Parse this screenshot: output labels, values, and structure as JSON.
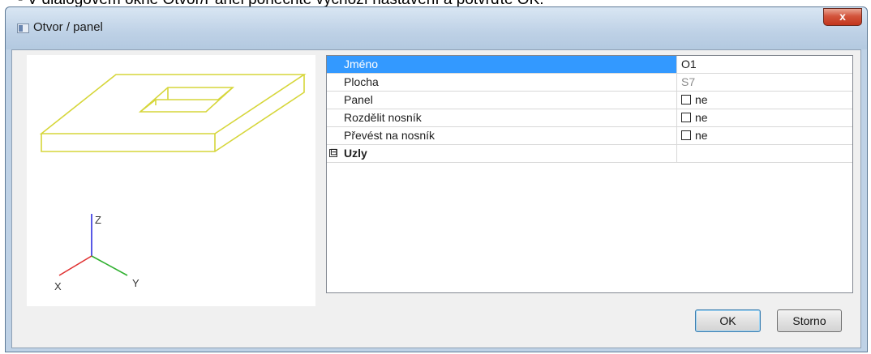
{
  "caption": "-   V dialogovém okně Otvor/Panel ponechte výchozí nastavení a potvrďte OK.",
  "window": {
    "title": "Otvor / panel",
    "close_label": "x",
    "app_icon": "window-icon"
  },
  "preview": {
    "axes": {
      "z": "Z",
      "x": "X",
      "y": "Y"
    },
    "colors": {
      "panel_outline": "#d6d63a",
      "x_axis": "#e03030",
      "y_axis": "#30b030",
      "z_axis": "#3030e0"
    }
  },
  "properties": [
    {
      "name": "Jméno",
      "value": "O1",
      "selected": true
    },
    {
      "name": "Plocha",
      "value": "S7",
      "readonly": true
    },
    {
      "name": "Panel",
      "value": "ne",
      "checkbox": true
    },
    {
      "name": "Rozdělit nosník",
      "value": "ne",
      "checkbox": true
    },
    {
      "name": "Převést na nosník",
      "value": "ne",
      "checkbox": true
    }
  ],
  "group": {
    "name": "Uzly",
    "toggle": "⊟",
    "value": ""
  },
  "buttons": {
    "ok": "OK",
    "cancel": "Storno"
  }
}
